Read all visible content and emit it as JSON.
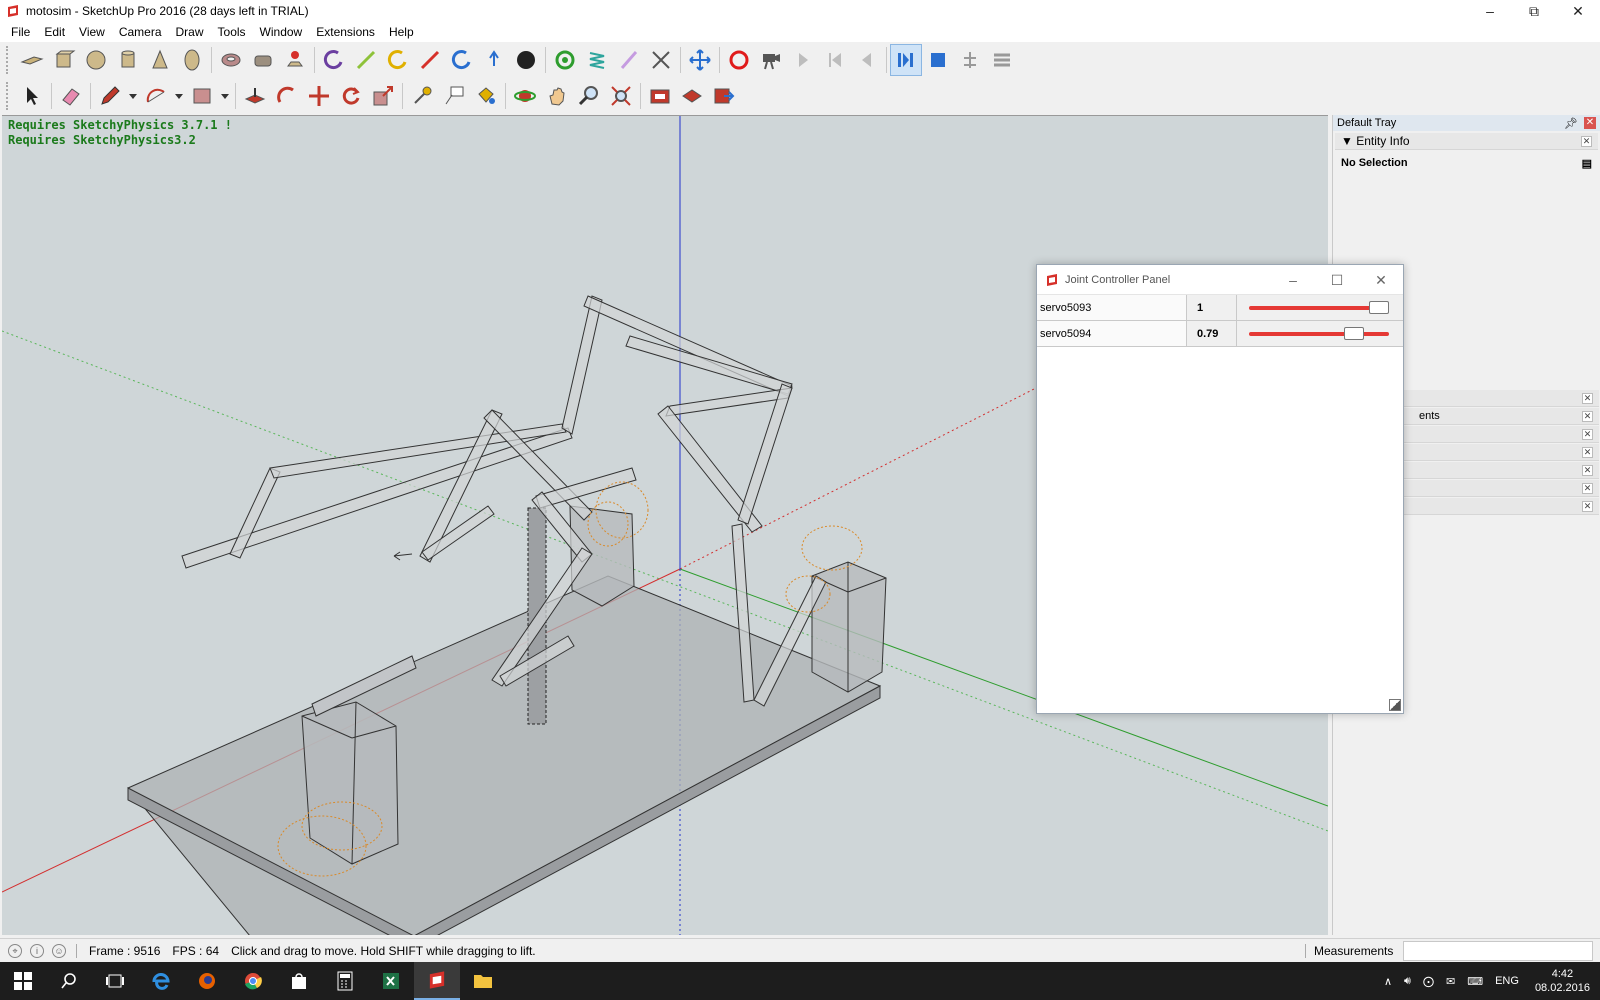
{
  "window": {
    "title": "motosim - SketchUp Pro 2016 (28 days left in TRIAL)"
  },
  "menu": [
    "File",
    "Edit",
    "View",
    "Camera",
    "Draw",
    "Tools",
    "Window",
    "Extensions",
    "Help"
  ],
  "viewport": {
    "warnings": [
      "Requires SketchyPhysics 3.7.1 !",
      "Requires SketchyPhysics3.2"
    ]
  },
  "tray": {
    "title": "Default Tray",
    "entity_info": {
      "label": "Entity Info",
      "selection": "No Selection"
    },
    "partial_label": "ents"
  },
  "joint_panel": {
    "title": "Joint Controller Panel",
    "joints": [
      {
        "name": "servo5093",
        "value": "1",
        "level": 1.0
      },
      {
        "name": "servo5094",
        "value": "0.79",
        "level": 0.79
      }
    ]
  },
  "status": {
    "frame": "Frame : 9516",
    "fps": "FPS : 64",
    "hint": "Click and drag to move. Hold SHIFT while dragging to lift.",
    "measurements_label": "Measurements",
    "measurements_value": ""
  },
  "taskbar": {
    "language": "ENG",
    "time": "4:42",
    "date": "08.02.2016"
  },
  "colors": {
    "axis_red": "#d32f2f",
    "axis_green": "#2e9d2e",
    "axis_blue": "#2233cc",
    "warning_green": "#1b7a1b",
    "slider_red": "#e53935"
  }
}
